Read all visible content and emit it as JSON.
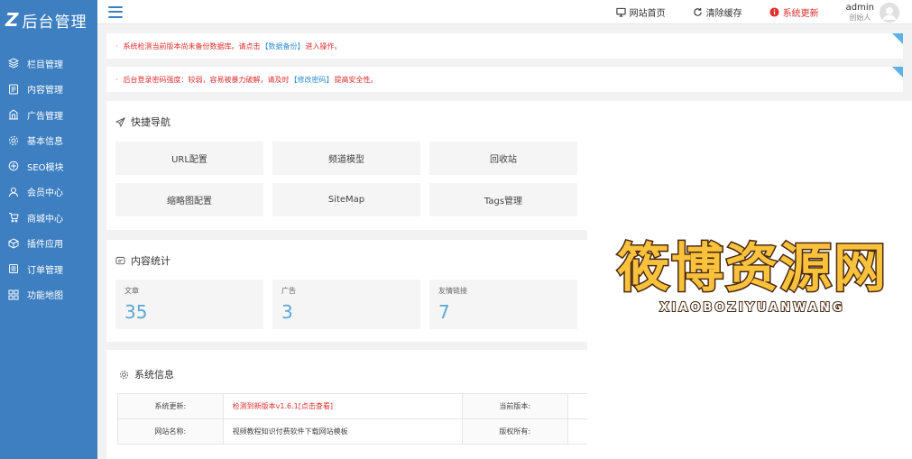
{
  "sidebar": {
    "logo_mark": "Z",
    "logo_text": "后台管理",
    "items": [
      {
        "label": "栏目管理",
        "icon": "layers-icon"
      },
      {
        "label": "内容管理",
        "icon": "document-icon"
      },
      {
        "label": "广告管理",
        "icon": "building-icon"
      },
      {
        "label": "基本信息",
        "icon": "gear-icon"
      },
      {
        "label": "SEO模块",
        "icon": "seo-icon"
      },
      {
        "label": "会员中心",
        "icon": "user-icon"
      },
      {
        "label": "商城中心",
        "icon": "cart-icon"
      },
      {
        "label": "插件应用",
        "icon": "cube-icon"
      },
      {
        "label": "订单管理",
        "icon": "list-icon"
      },
      {
        "label": "功能地图",
        "icon": "grid-icon"
      }
    ]
  },
  "header": {
    "links": {
      "home": "网站首页",
      "clear_cache": "清除缓存",
      "update": "系统更新"
    },
    "user": {
      "name": "admin",
      "role": "创始人"
    }
  },
  "notices": [
    {
      "prefix": "系统检测当前版本尚未备份数据库。请点击",
      "link": "【数据备份】",
      "suffix": "进入操作。"
    },
    {
      "prefix": "后台登录密码强度：较弱，容易被暴力破解，请及时",
      "link": "【修改密码】",
      "suffix": "提高安全性。"
    }
  ],
  "quick_nav": {
    "title": "快捷导航",
    "buttons": [
      "URL配置",
      "频道模型",
      "回收站",
      "缩略图配置",
      "SiteMap",
      "Tags管理"
    ]
  },
  "stats": {
    "title": "内容统计",
    "items": [
      {
        "label": "文章",
        "value": "35"
      },
      {
        "label": "广告",
        "value": "3"
      },
      {
        "label": "友情链接",
        "value": "7"
      }
    ]
  },
  "system_info": {
    "title": "系统信息",
    "rows": [
      {
        "label1": "系统更新:",
        "value1": "检测到新版本v1.6.1[点击查看]",
        "label2": "当前版本:"
      },
      {
        "label1": "网站名称:",
        "value1": "视频教程知识付费软件下载网站模板",
        "label2": "版权所有:"
      }
    ]
  },
  "watermark": {
    "main": "筱博资源网",
    "sub": "XIAOBOZIYUANWANG"
  },
  "colors": {
    "sidebar": "#3d7fc1",
    "accent_red": "#e02d2d",
    "link_blue": "#2d8ccf",
    "stat_blue": "#5ba8d8",
    "watermark_yellow": "#f9c23c"
  }
}
